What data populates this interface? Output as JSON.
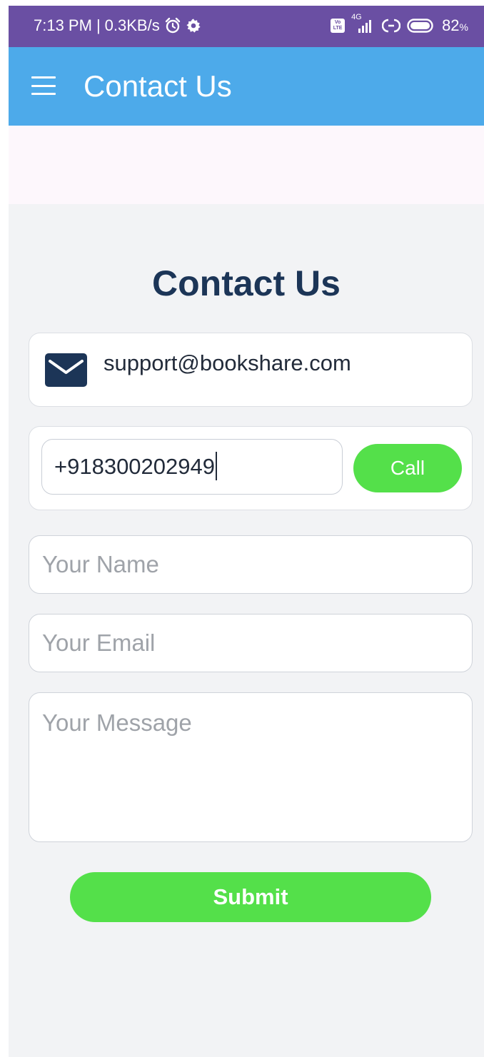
{
  "status_bar": {
    "time": "7:13 PM",
    "separator": "|",
    "speed": "0.3KB/s",
    "network_type": "4G",
    "volte_top": "Vo",
    "volte_bottom": "LTE",
    "battery_value": "82",
    "battery_unit": "%",
    "icons": [
      "alarm-icon",
      "settings-gear-icon",
      "volte-icon",
      "signal-icon",
      "hotspot-icon",
      "battery-icon"
    ]
  },
  "app_bar": {
    "title": "Contact Us",
    "menu_icon": "hamburger-menu-icon"
  },
  "content": {
    "heading": "Contact Us",
    "email_card": {
      "icon": "mail-envelope-icon",
      "email": "support@bookshare.com"
    },
    "phone_card": {
      "phone_value": "+918300202949",
      "call_label": "Call"
    },
    "form": {
      "name_placeholder": "Your Name",
      "email_placeholder": "Your Email",
      "message_placeholder": "Your Message",
      "submit_label": "Submit"
    }
  },
  "colors": {
    "status_bar": "#6a4fa3",
    "app_bar": "#4daaea",
    "heading": "#1c3557",
    "accent_green": "#54e04a",
    "page_background": "#f2f3f5"
  }
}
